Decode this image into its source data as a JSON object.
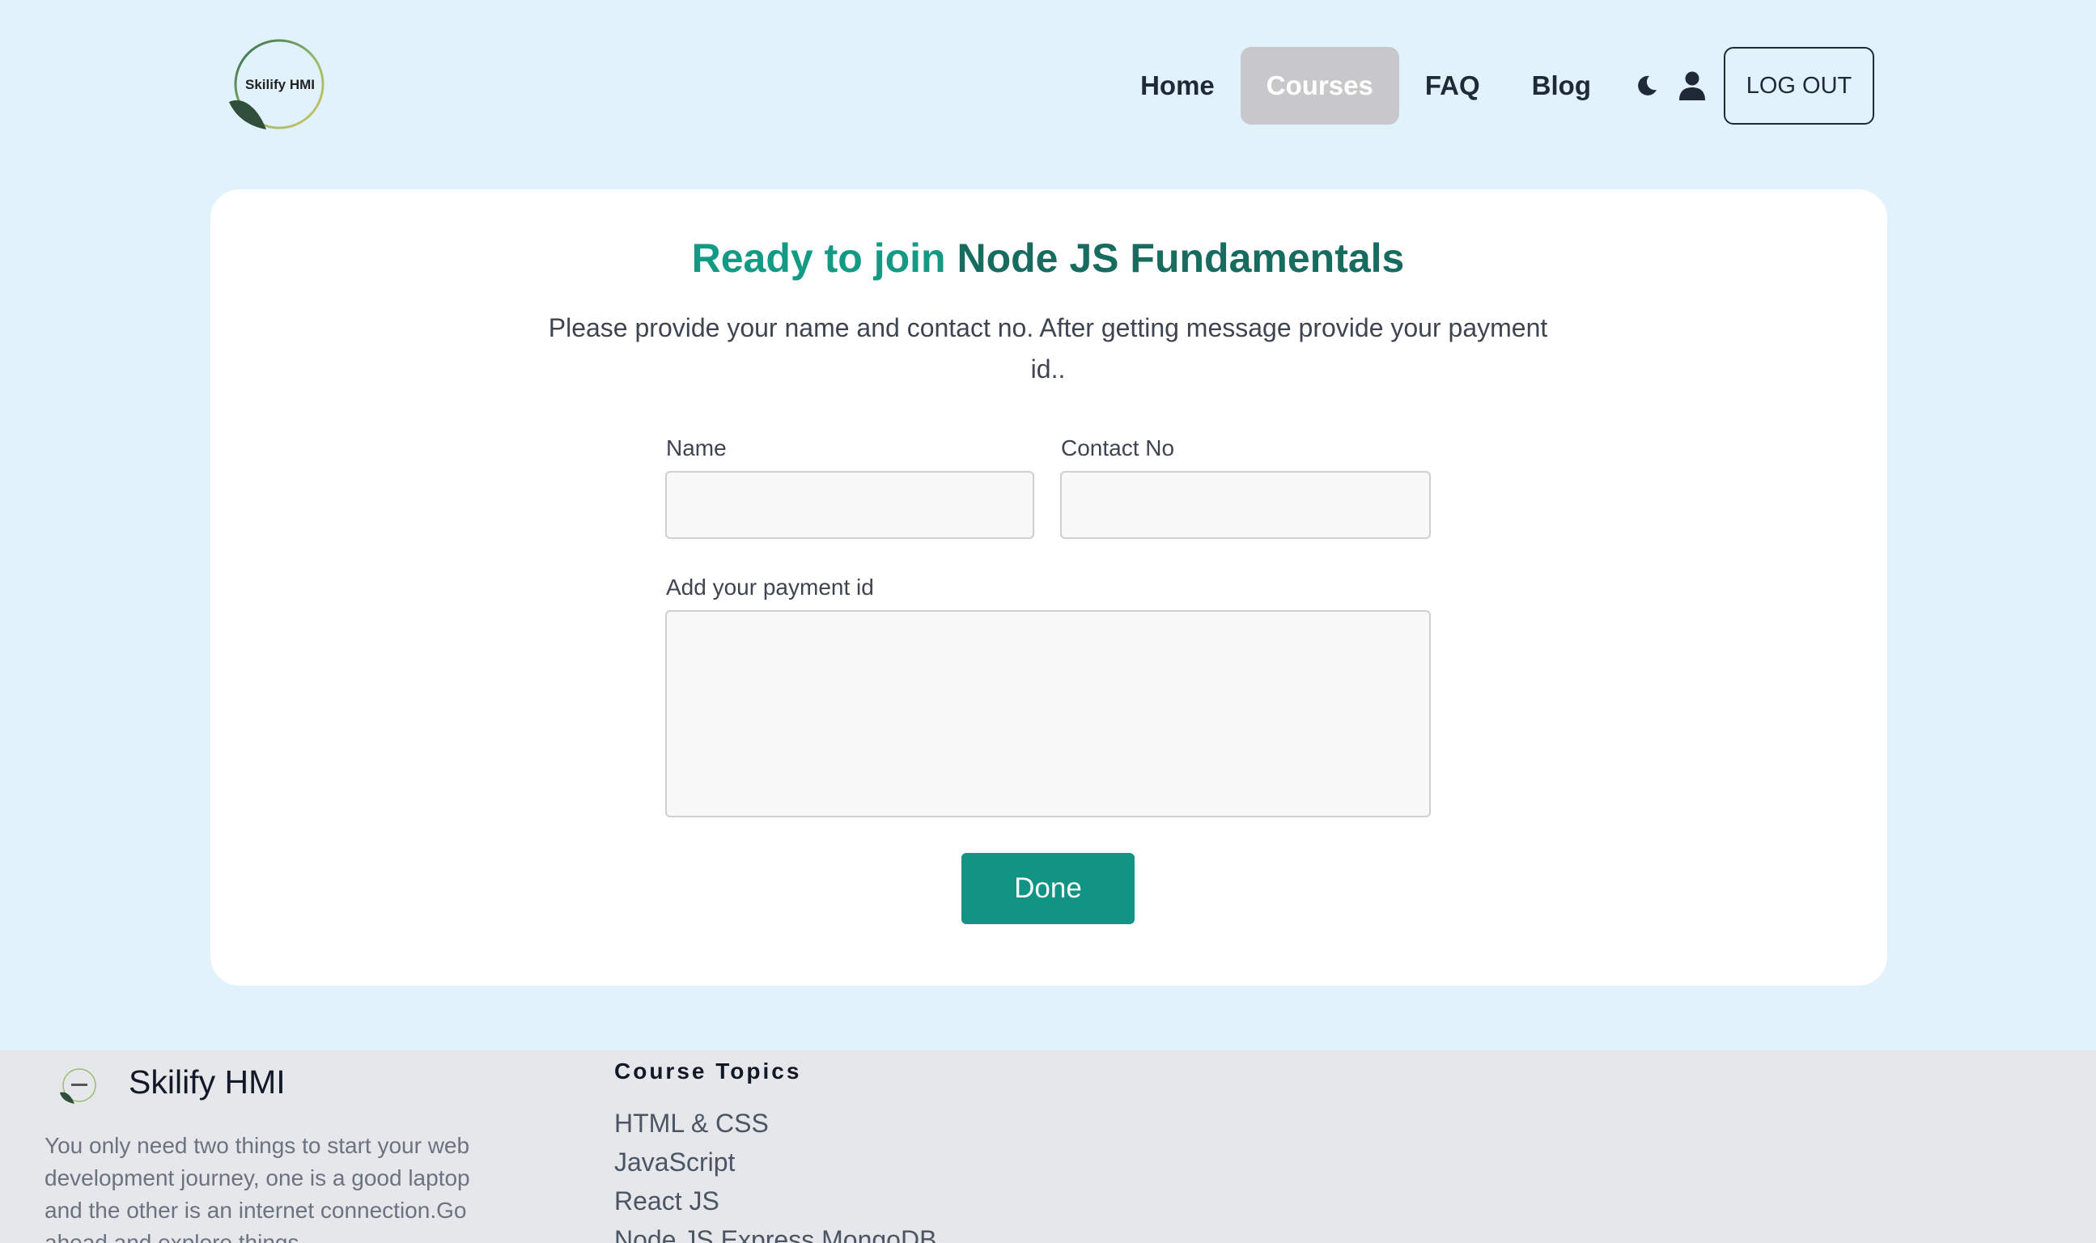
{
  "brand": {
    "logo_text": "Skilify HMI",
    "name": "Skilify HMI"
  },
  "nav": {
    "items": [
      {
        "label": "Home"
      },
      {
        "label": "Courses",
        "active": true
      },
      {
        "label": "FAQ"
      },
      {
        "label": "Blog"
      }
    ],
    "theme_icon": "moon-icon",
    "profile_icon": "user-icon",
    "logout_label": "LOG OUT"
  },
  "join": {
    "title_prefix": "Ready to join",
    "course_name": "Node JS Fundamentals",
    "instructions": "Please provide your name and contact no. After getting message provide your payment id..",
    "name_label": "Name",
    "name_value": "",
    "contact_label": "Contact No",
    "contact_value": "",
    "payment_label": "Add your payment id",
    "payment_value": "",
    "submit_label": "Done"
  },
  "footer": {
    "brand": "Skilify HMI",
    "description": "You only need two things to start your web development journey, one is a good laptop and the other is an internet connection.Go ahead and explore things.",
    "topics_title": "Course Topics",
    "topics": [
      "HTML & CSS",
      "JavaScript",
      "React JS",
      "Node JS,Express,MongoDB"
    ]
  },
  "colors": {
    "page_bg": "#e1f2fd",
    "accent": "#139383",
    "title_primary": "#139a85",
    "title_secondary": "#176b5f",
    "nav_active_bg": "#c8c8ca",
    "footer_bg": "#e5e7eb"
  }
}
